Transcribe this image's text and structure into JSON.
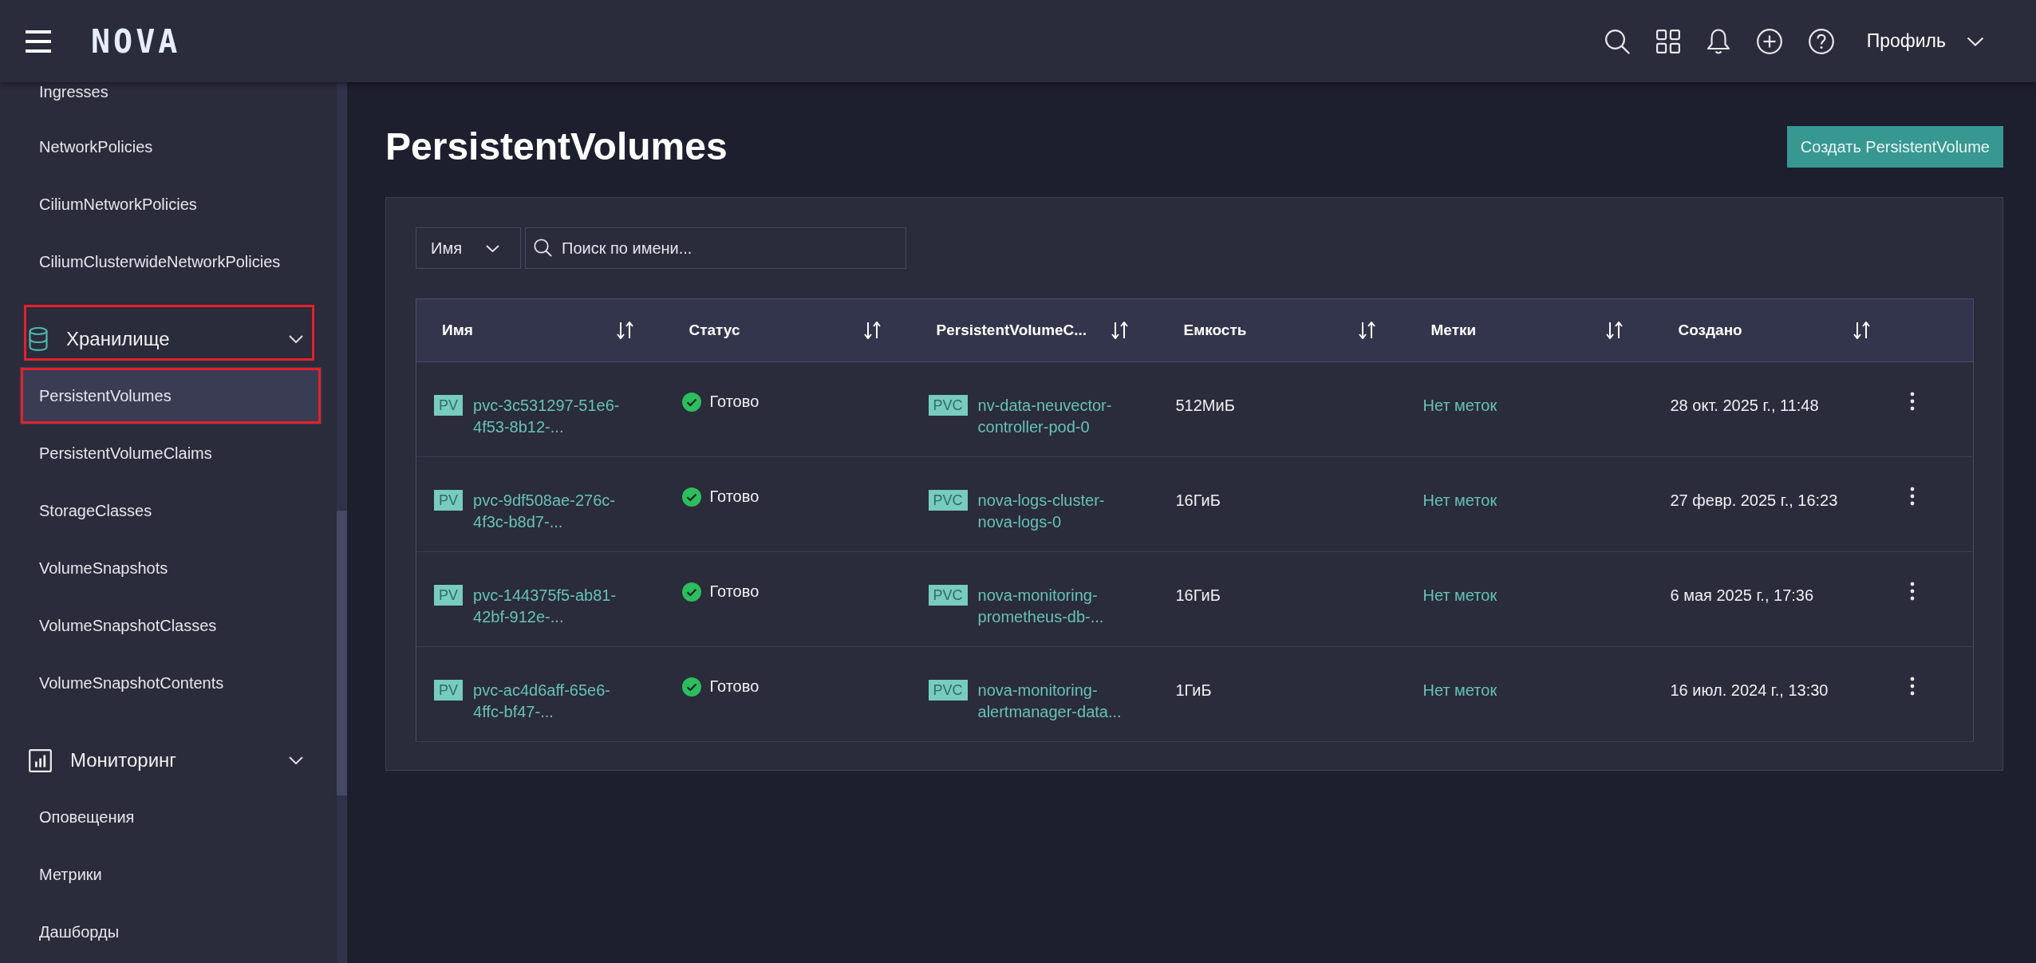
{
  "topbar": {
    "logo": "NOVA",
    "profile": {
      "label": "Профиль"
    }
  },
  "sidebar": {
    "items": [
      {
        "kind": "link",
        "label": "Ingresses",
        "selected": false,
        "highlighted": false
      },
      {
        "kind": "link",
        "label": "NetworkPolicies",
        "selected": false,
        "highlighted": false
      },
      {
        "kind": "link",
        "label": "CiliumNetworkPolicies",
        "selected": false,
        "highlighted": false
      },
      {
        "kind": "link",
        "label": "CiliumClusterwideNetworkPolicies",
        "selected": false,
        "highlighted": false
      },
      {
        "kind": "group",
        "label": "Хранилище",
        "expanded": true,
        "highlighted": true,
        "children": [
          {
            "label": "PersistentVolumes",
            "selected": true,
            "highlighted": true
          },
          {
            "label": "PersistentVolumeClaims",
            "selected": false,
            "highlighted": false
          },
          {
            "label": "StorageClasses",
            "selected": false,
            "highlighted": false
          },
          {
            "label": "VolumeSnapshots",
            "selected": false,
            "highlighted": false
          },
          {
            "label": "VolumeSnapshotClasses",
            "selected": false,
            "highlighted": false
          },
          {
            "label": "VolumeSnapshotContents",
            "selected": false,
            "highlighted": false
          }
        ]
      },
      {
        "kind": "group",
        "label": "Мониторинг",
        "expanded": true,
        "highlighted": false,
        "children": [
          {
            "label": "Оповещения",
            "selected": false,
            "highlighted": false
          },
          {
            "label": "Метрики",
            "selected": false,
            "highlighted": false
          },
          {
            "label": "Дашборды",
            "selected": false,
            "highlighted": false
          }
        ]
      }
    ]
  },
  "page": {
    "title": "PersistentVolumes",
    "create_button": "Создать PersistentVolume"
  },
  "filter": {
    "field": "Имя",
    "search": {
      "placeholder": "Поиск по имени..."
    }
  },
  "table": {
    "columns": [
      {
        "label": "Имя",
        "sortable": true
      },
      {
        "label": "Статус",
        "sortable": true
      },
      {
        "label": "PersistentVolumeC...",
        "sortable": true
      },
      {
        "label": "Емкость",
        "sortable": true
      },
      {
        "label": "Метки",
        "sortable": true
      },
      {
        "label": "Создано",
        "sortable": true
      }
    ],
    "rows": [
      {
        "name_tag": "PV",
        "name": "pvc-3c531297-51e6-4f53-8b12-...",
        "status": {
          "kind": "ready",
          "label": "Готово"
        },
        "claim_tag": "PVC",
        "claim": "nv-data-neuvector-controller-pod-0",
        "capacity": "512МиБ",
        "labels": "Нет меток",
        "created": "28 окт. 2025 г., 11:48"
      },
      {
        "name_tag": "PV",
        "name": "pvc-9df508ae-276c-4f3c-b8d7-...",
        "status": {
          "kind": "ready",
          "label": "Готово"
        },
        "claim_tag": "PVC",
        "claim": "nova-logs-cluster-nova-logs-0",
        "capacity": "16ГиБ",
        "labels": "Нет меток",
        "created": "27 февр. 2025 г., 16:23"
      },
      {
        "name_tag": "PV",
        "name": "pvc-144375f5-ab81-42bf-912e-...",
        "status": {
          "kind": "ready",
          "label": "Готово"
        },
        "claim_tag": "PVC",
        "claim": "nova-monitoring-prometheus-db-...",
        "capacity": "16ГиБ",
        "labels": "Нет меток",
        "created": "6 мая 2025 г., 17:36"
      },
      {
        "name_tag": "PV",
        "name": "pvc-ac4d6aff-65e6-4ffc-bf47-...",
        "status": {
          "kind": "ready",
          "label": "Готово"
        },
        "claim_tag": "PVC",
        "claim": "nova-monitoring-alertmanager-data...",
        "capacity": "1ГиБ",
        "labels": "Нет меток",
        "created": "16 июл. 2024 г., 13:30"
      }
    ]
  }
}
